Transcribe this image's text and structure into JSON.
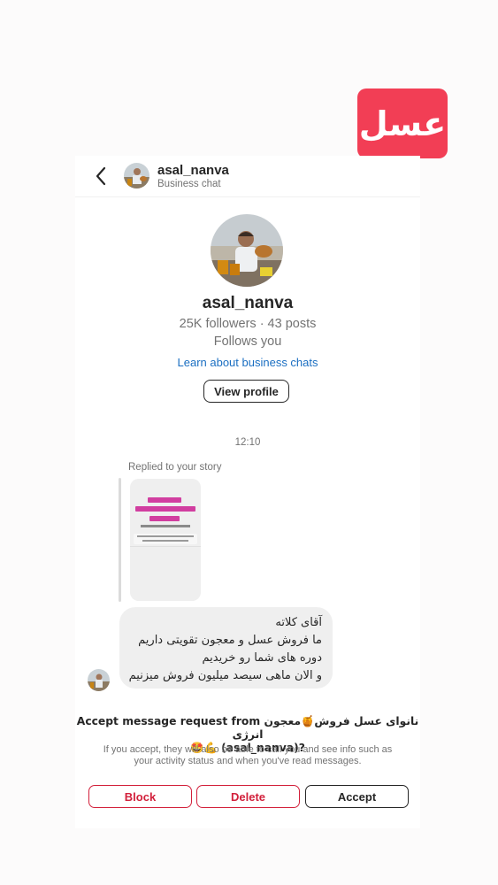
{
  "overlay": {
    "badge_text": "عسل"
  },
  "header": {
    "username": "asal_nanva",
    "subtitle": "Business chat"
  },
  "profile": {
    "name": "asal_nanva",
    "stats": "25K followers · 43 posts",
    "follows": "Follows you",
    "learn_link": "Learn about business chats",
    "view_button": "View profile"
  },
  "chat": {
    "timestamp": "12:10",
    "replied_label": "Replied to your story",
    "message_lines": [
      "آقای کلاته",
      "ما فروش عسل و معجون تقویتی داریم",
      "دوره های شما رو خریدیم",
      "و الان ماهی سیصد میلیون فروش میزنیم"
    ]
  },
  "request": {
    "title_line1": "Accept message request from نانوای عسل فروش🍯معجون انرژی",
    "title_line2": "🤩💪 (asal_nanva)?",
    "description": "If you accept, they will also be able to call you and see info such as your activity status and when you've read messages.",
    "block_label": "Block",
    "delete_label": "Delete",
    "accept_label": "Accept"
  },
  "colors": {
    "badge": "#f23e55",
    "danger": "#d2203b",
    "link": "#1b6fc2",
    "bubble": "#efefef"
  }
}
